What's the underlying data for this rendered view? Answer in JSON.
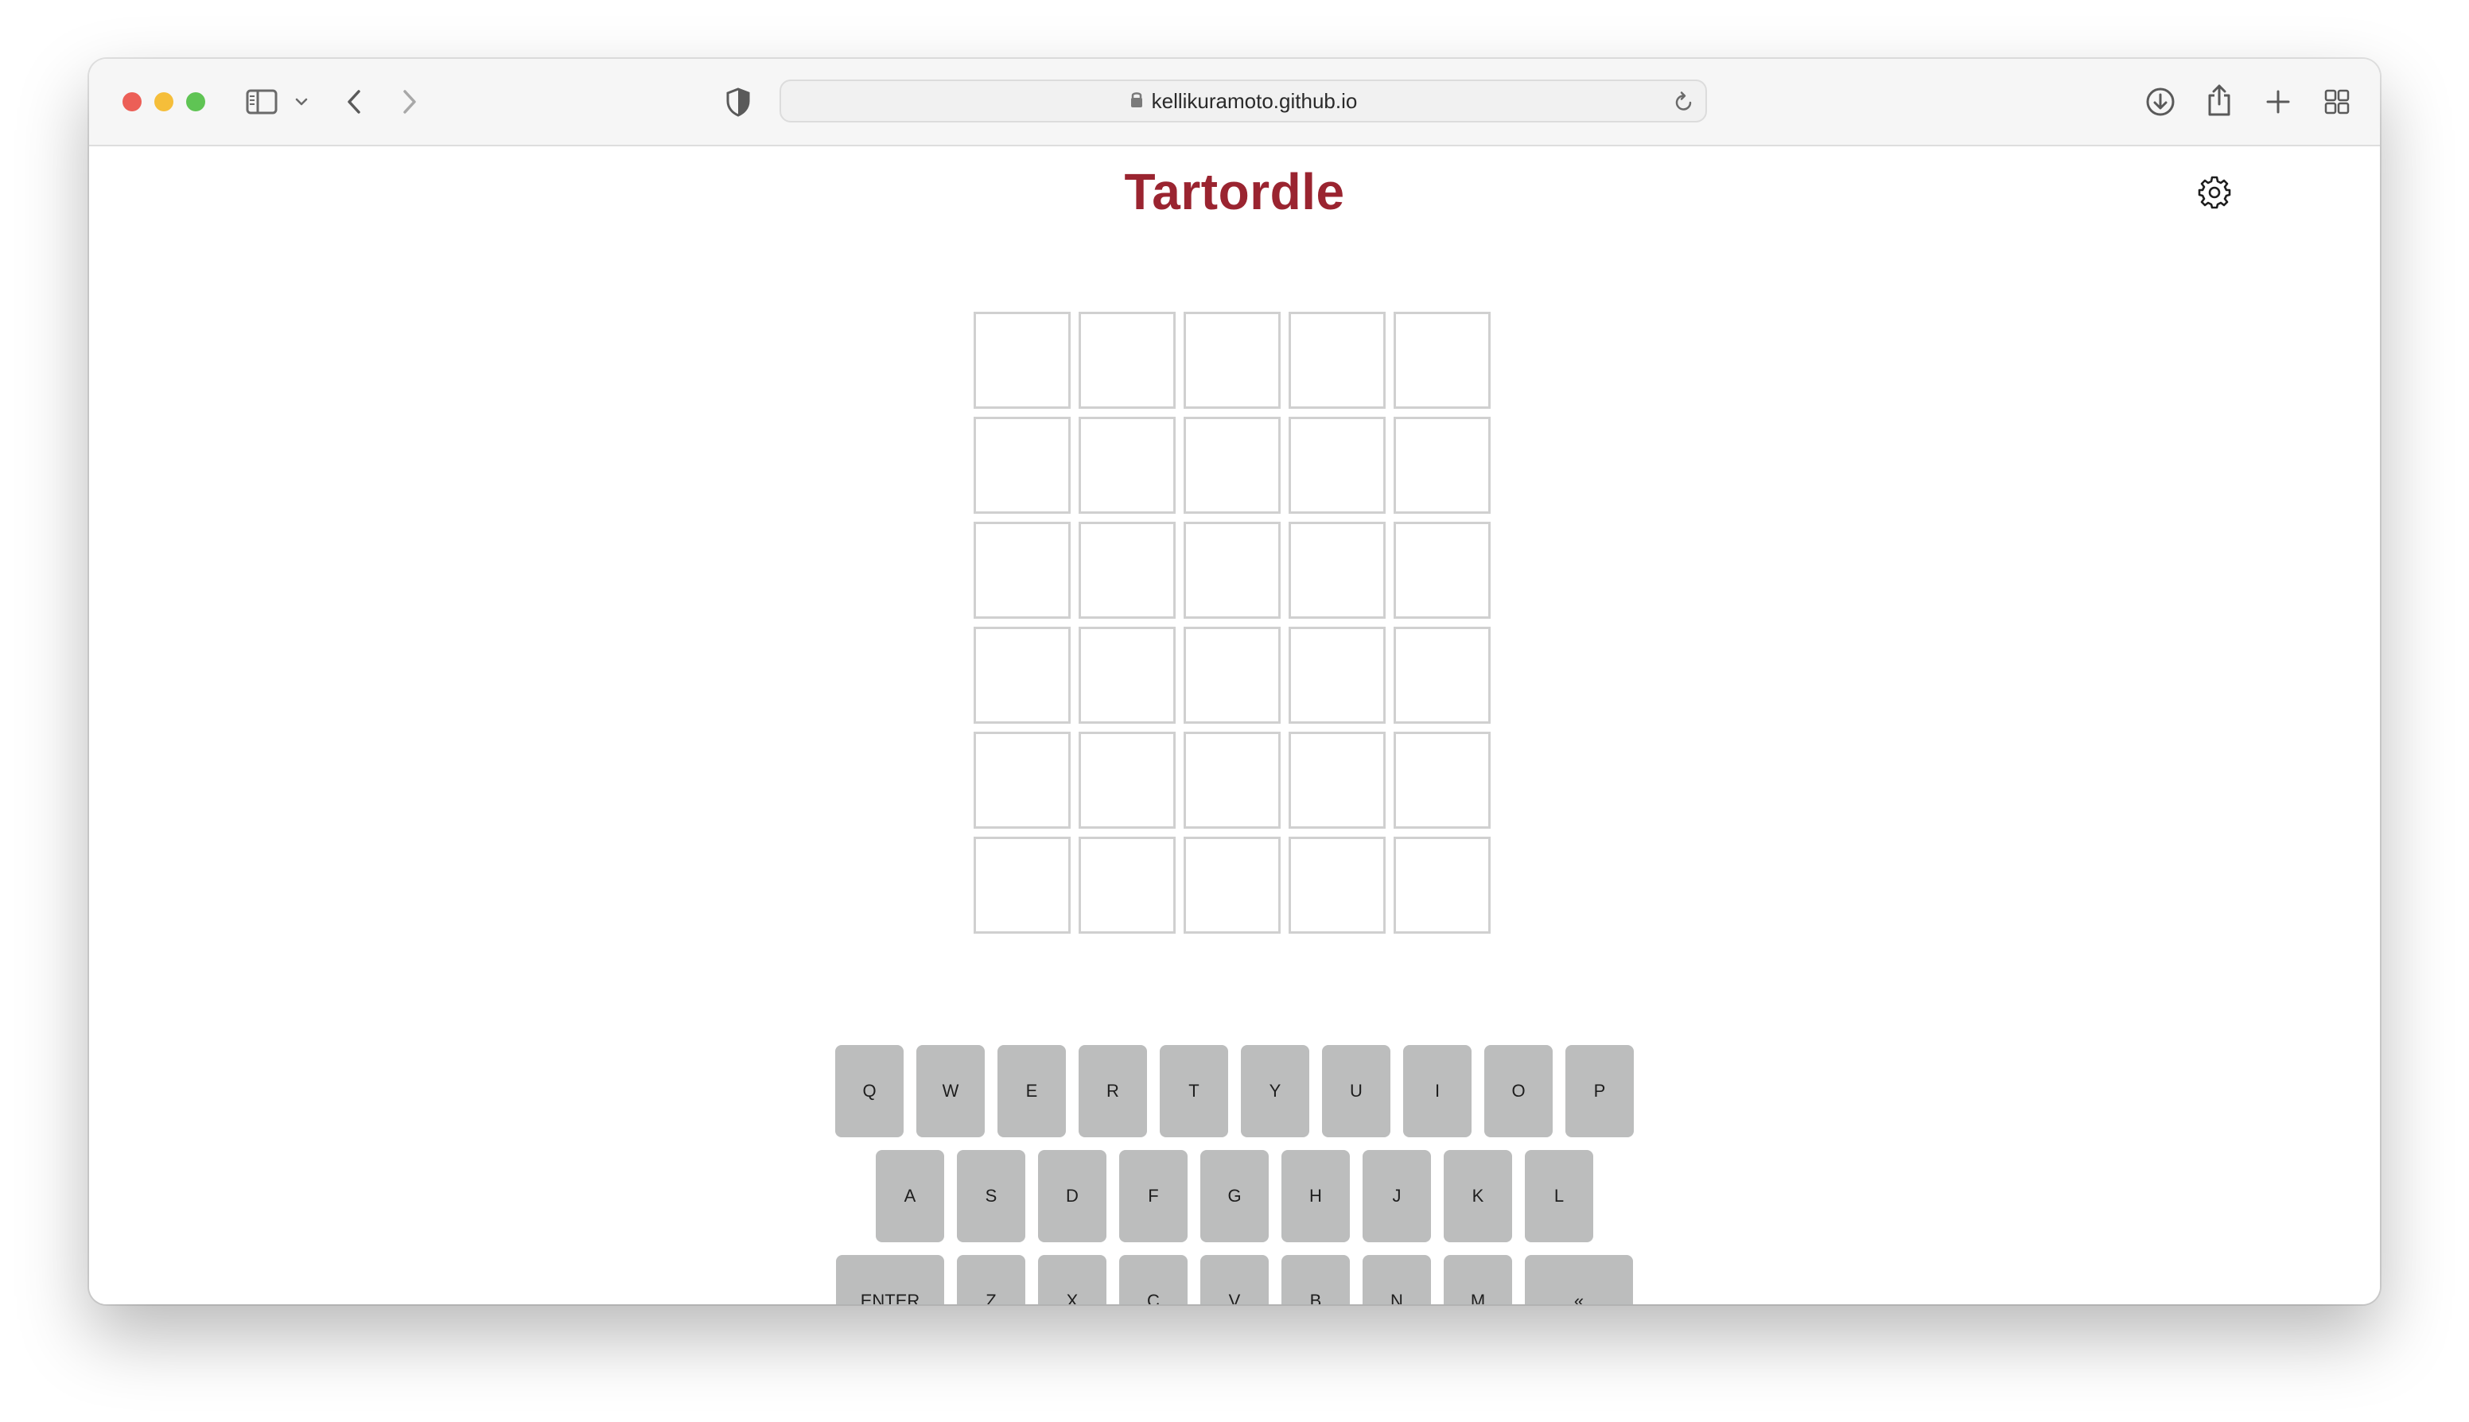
{
  "browser": {
    "url": "kellikuramoto.github.io",
    "traffic_colors": {
      "close": "#ec5f57",
      "minimize": "#f5be3a",
      "zoom": "#5fc454"
    },
    "icons": {
      "sidebar": "sidebar-toggle-icon",
      "tab_overview_menu": "chevron-down-icon",
      "back": "chevron-left-icon",
      "forward": "chevron-right-icon",
      "privacy": "shield-icon",
      "secure": "lock-icon",
      "reload": "reload-icon",
      "downloads": "download-icon",
      "share": "share-icon",
      "new_tab": "plus-icon",
      "tab_overview": "grid-icon"
    }
  },
  "game": {
    "title": "Tartordle",
    "title_color": "#9a2430",
    "settings_icon": "gear-icon",
    "board": {
      "rows": [
        [
          "",
          "",
          "",
          "",
          ""
        ],
        [
          "",
          "",
          "",
          "",
          ""
        ],
        [
          "",
          "",
          "",
          "",
          ""
        ],
        [
          "",
          "",
          "",
          "",
          ""
        ],
        [
          "",
          "",
          "",
          "",
          ""
        ],
        [
          "",
          "",
          "",
          "",
          ""
        ]
      ],
      "tile_border_color": "#d0d0d0"
    },
    "keyboard": {
      "key_color": "#bcbdbd",
      "rows": [
        [
          "Q",
          "W",
          "E",
          "R",
          "T",
          "Y",
          "U",
          "I",
          "O",
          "P"
        ],
        [
          "A",
          "S",
          "D",
          "F",
          "G",
          "H",
          "J",
          "K",
          "L"
        ],
        [
          "ENTER",
          "Z",
          "X",
          "C",
          "V",
          "B",
          "N",
          "M",
          "«"
        ]
      ]
    }
  }
}
